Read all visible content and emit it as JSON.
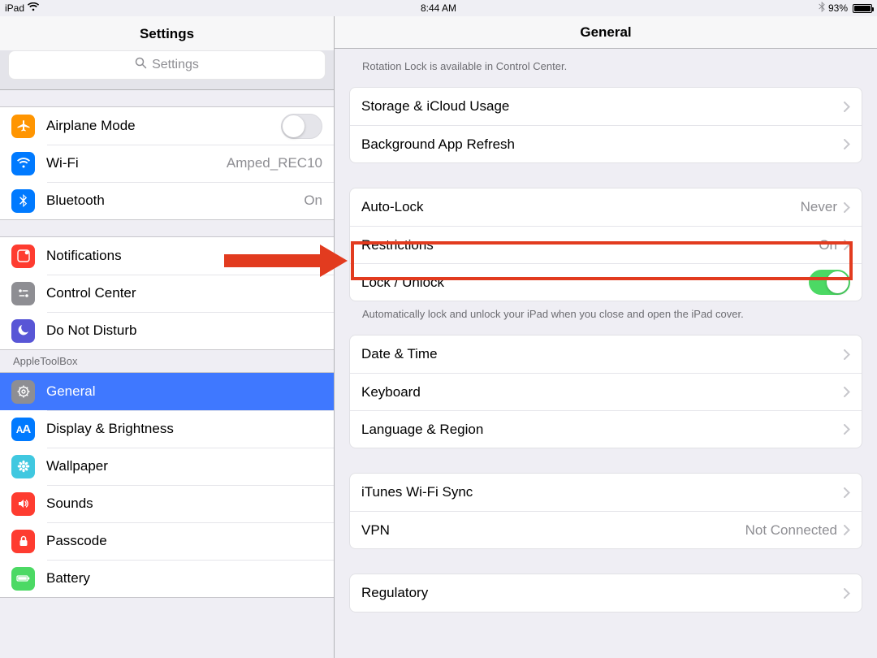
{
  "statusbar": {
    "carrier": "iPad",
    "time": "8:44 AM",
    "battery_percent": "93%"
  },
  "sidebar": {
    "title": "Settings",
    "search_placeholder": "Settings",
    "group_connectivity": [
      {
        "label": "Airplane Mode",
        "icon": "airplane",
        "icon_bg": "#ff9501",
        "switch": false
      },
      {
        "label": "Wi-Fi",
        "icon": "wifi",
        "icon_bg": "#007aff",
        "value": "Amped_REC10"
      },
      {
        "label": "Bluetooth",
        "icon": "bluetooth",
        "icon_bg": "#007aff",
        "value": "On"
      }
    ],
    "group_notifications": [
      {
        "label": "Notifications",
        "icon": "bell-badge",
        "icon_bg": "#fe3c30"
      },
      {
        "label": "Control Center",
        "icon": "control",
        "icon_bg": "#8e8e93"
      },
      {
        "label": "Do Not Disturb",
        "icon": "moon",
        "icon_bg": "#5856d6"
      }
    ],
    "account_header": "AppleToolBox",
    "group_device": [
      {
        "label": "General",
        "icon": "gear",
        "icon_bg": "#8e8e93",
        "selected": true
      },
      {
        "label": "Display & Brightness",
        "icon": "aa",
        "icon_bg": "#007aff"
      },
      {
        "label": "Wallpaper",
        "icon": "flower",
        "icon_bg": "#40c8e0"
      },
      {
        "label": "Sounds",
        "icon": "speaker",
        "icon_bg": "#fe3c30"
      },
      {
        "label": "Passcode",
        "icon": "lock",
        "icon_bg": "#fe3c30"
      },
      {
        "label": "Battery",
        "icon": "battery",
        "icon_bg": "#4cd964"
      }
    ]
  },
  "detail": {
    "title": "General",
    "header_note": "Rotation Lock is available in Control Center.",
    "group_storage": [
      {
        "label": "Storage & iCloud Usage"
      },
      {
        "label": "Background App Refresh"
      }
    ],
    "group_lock": [
      {
        "label": "Auto-Lock",
        "value": "Never"
      },
      {
        "label": "Restrictions",
        "value": "On",
        "highlighted": true
      },
      {
        "label": "Lock / Unlock",
        "switch": true
      }
    ],
    "lock_footer": "Automatically lock and unlock your iPad when you close and open the iPad cover.",
    "group_locale": [
      {
        "label": "Date & Time"
      },
      {
        "label": "Keyboard"
      },
      {
        "label": "Language & Region"
      }
    ],
    "group_net": [
      {
        "label": "iTunes Wi-Fi Sync"
      },
      {
        "label": "VPN",
        "value": "Not Connected"
      }
    ],
    "group_reg": [
      {
        "label": "Regulatory"
      }
    ]
  }
}
